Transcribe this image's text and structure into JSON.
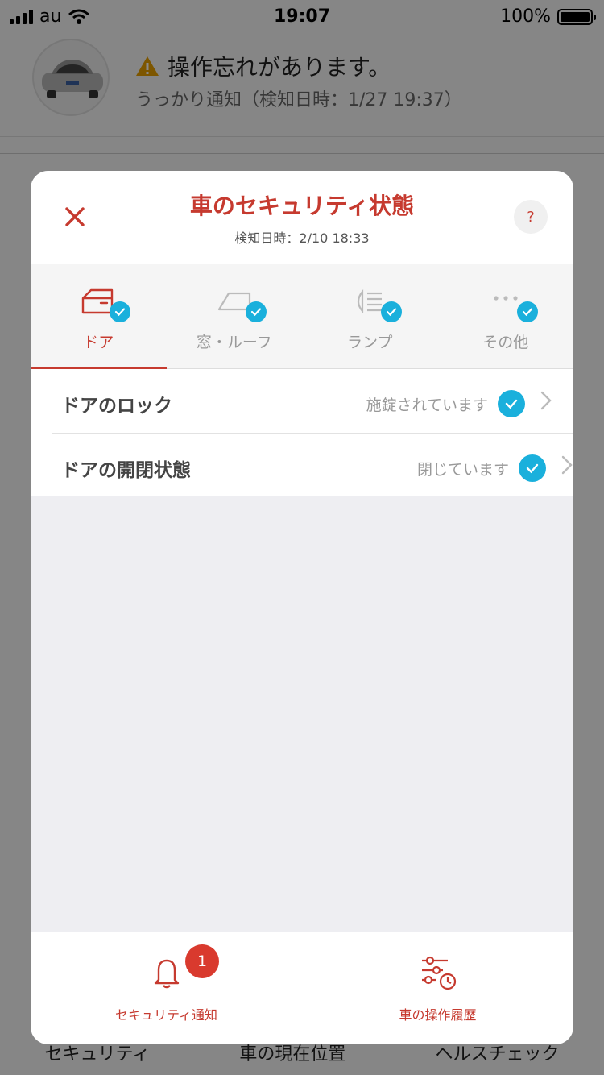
{
  "status_bar": {
    "carrier": "au",
    "time": "19:07",
    "battery": "100%"
  },
  "background": {
    "notice_title": "操作忘れがあります。",
    "notice_sub": "うっかり通知（検知日時：1/27 19:37）",
    "bottom_nav": [
      "セキュリティ",
      "車の現在位置",
      "ヘルスチェック"
    ]
  },
  "modal": {
    "title": "車のセキュリティ状態",
    "subtitle": "検知日時：2/10 18:33",
    "help_label": "?",
    "tabs": [
      {
        "label": "ドア",
        "icon": "door-icon",
        "active": true
      },
      {
        "label": "窓・ルーフ",
        "icon": "window-roof-icon",
        "active": false
      },
      {
        "label": "ランプ",
        "icon": "lamp-icon",
        "active": false
      },
      {
        "label": "その他",
        "icon": "more-icon",
        "active": false
      }
    ],
    "rows": [
      {
        "label": "ドアのロック",
        "status": "施錠されています"
      },
      {
        "label": "ドアの開閉状態",
        "status": "閉じています"
      }
    ],
    "footer": [
      {
        "label": "セキュリティ通知",
        "icon": "bell-icon",
        "badge": "1"
      },
      {
        "label": "車の操作履歴",
        "icon": "history-icon"
      }
    ]
  },
  "colors": {
    "accent": "#c63a2f",
    "check": "#1ab0dc",
    "badge": "#d93a2e"
  }
}
